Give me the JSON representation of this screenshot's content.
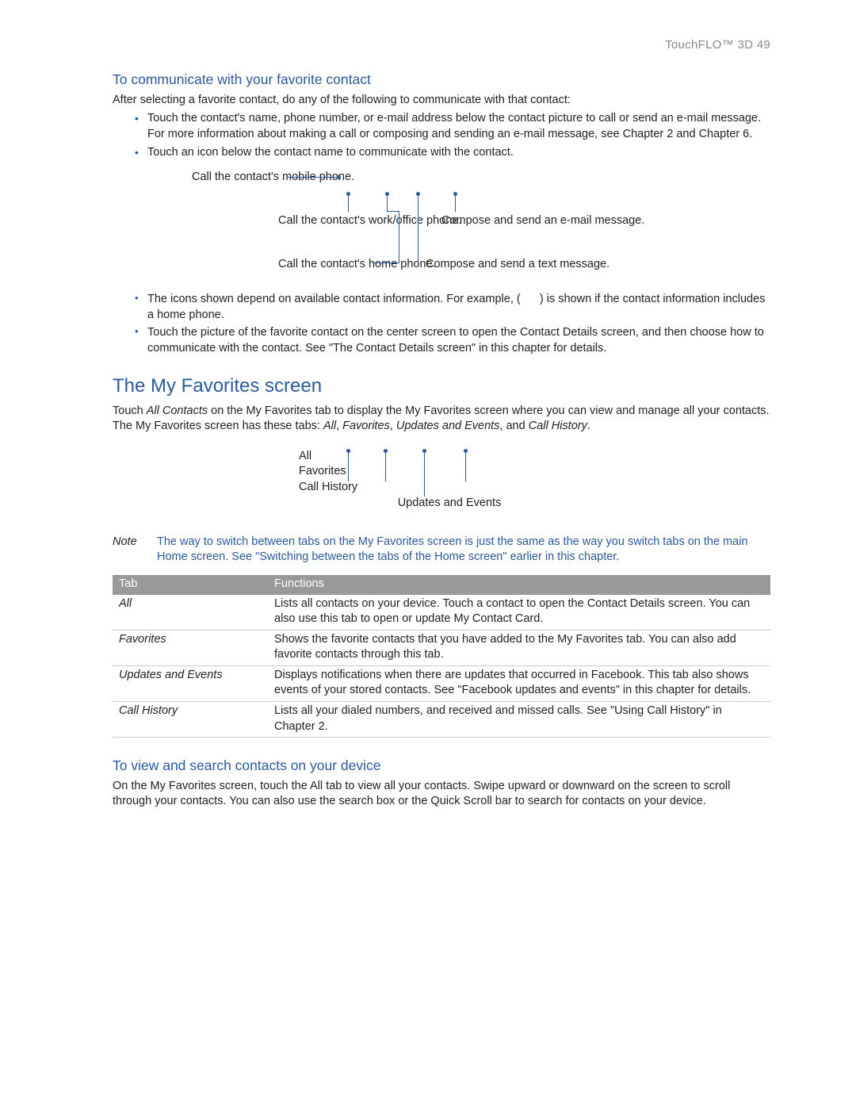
{
  "header": {
    "section": "TouchFLO™ 3D",
    "page_num": "  49"
  },
  "h3_1": "To communicate with your favorite contact",
  "p1": "After selecting a favorite contact, do any of the following to communicate with that contact:",
  "bullets1": {
    "b1": "Touch the contact's name, phone number, or e-mail address below the contact picture to call or send an e-mail message. For more information about making a call or composing and sending an e-mail message, see Chapter 2 and Chapter 6.",
    "b2": "Touch an icon below the contact name to communicate with the contact."
  },
  "callouts": {
    "mobile": "Call the contact's mobile phone.",
    "work": "Call the contact's work/office phone.",
    "home": "Call the contact's home phone.",
    "email": "Compose and send an e-mail message.",
    "text": "Compose and send a text message."
  },
  "bullets2": {
    "b1a": "The icons shown depend on available contact information. For example, (",
    "b1b": ") is shown if the contact information includes a home phone.",
    "b2": "Touch the picture of the favorite contact on the center screen to open the Contact Details screen, and then choose how to communicate with the contact. See \"The Contact Details screen\" in this chapter for details."
  },
  "h2_1": "The My Favorites screen",
  "p2a": "Touch ",
  "p2b_italic": "All Contacts",
  "p2c": " on the My Favorites tab to display the My Favorites screen where you can view and manage all your contacts. The My Favorites screen has these tabs: ",
  "p2d_italic": "All",
  "p2e": ", ",
  "p2f_italic": "Favorites",
  "p2g": ", ",
  "p2h_italic": "Updates and Events",
  "p2i": ", and ",
  "p2j_italic": "Call History",
  "p2k": ".",
  "tablabels": {
    "all": "All",
    "favorites": "Favorites",
    "history": "Call History",
    "updates": "Updates and Events"
  },
  "note": {
    "label": "Note",
    "body": "The way to switch between tabs on the My Favorites screen is just the same as the way you switch tabs on the main Home screen. See \"Switching between the tabs of the Home screen\" earlier in this chapter."
  },
  "table": {
    "h1": "Tab",
    "h2": "Functions",
    "rows": {
      "r1t": "All",
      "r1f": "Lists all contacts on your device. Touch a contact to open the Contact Details screen. You can also use this tab to open or update My Contact Card.",
      "r2t": "Favorites",
      "r2f": "Shows the favorite contacts that you have added to the My Favorites tab. You can also add favorite contacts through this tab.",
      "r3t": "Updates and Events",
      "r3f": "Displays notifications when there are updates that occurred in Facebook. This tab also shows events of your stored contacts. See \"Facebook updates and events\" in this chapter for details.",
      "r4t": "Call History",
      "r4f": "Lists all your dialed numbers, and received and missed calls. See \"Using Call History\" in Chapter 2."
    }
  },
  "h3_2": "To view and search contacts on your device",
  "p3": "On the My Favorites screen, touch the All tab to view all your contacts. Swipe upward or downward on the screen to scroll through your contacts. You can also use the search box or the Quick Scroll bar to search for contacts on your device."
}
